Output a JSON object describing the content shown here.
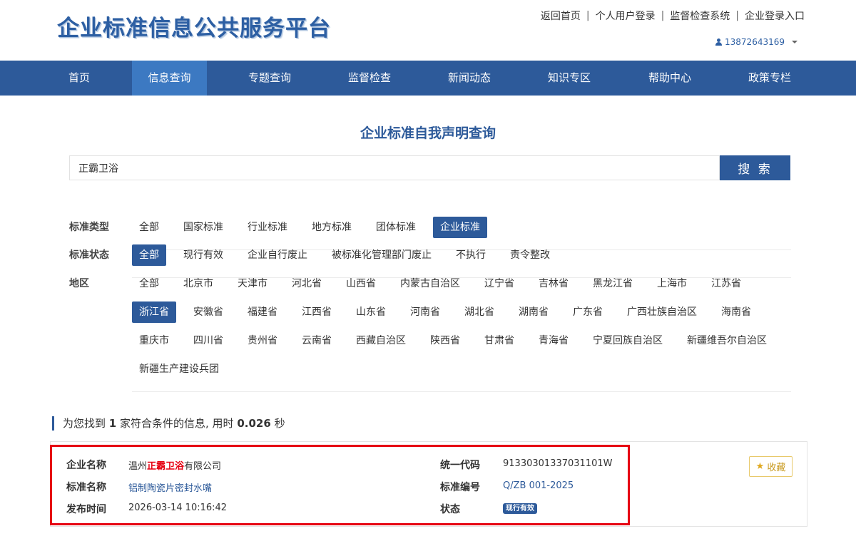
{
  "header": {
    "logo": "企业标准信息公共服务平台",
    "links": [
      "返回首页",
      "个人用户登录",
      "监督检查系统",
      "企业登录入口"
    ],
    "user": "13872643169"
  },
  "nav": {
    "items": [
      "首页",
      "信息查询",
      "专题查询",
      "监督检查",
      "新闻动态",
      "知识专区",
      "帮助中心",
      "政策专栏"
    ],
    "active": "信息查询"
  },
  "search": {
    "title": "企业标准自我声明查询",
    "value": "正霸卫浴",
    "button": "搜 索"
  },
  "filters": {
    "type": {
      "label": "标准类型",
      "options": [
        "全部",
        "国家标准",
        "行业标准",
        "地方标准",
        "团体标准",
        "企业标准"
      ],
      "selected": "企业标准"
    },
    "status": {
      "label": "标准状态",
      "options": [
        "全部",
        "现行有效",
        "企业自行废止",
        "被标准化管理部门废止",
        "不执行",
        "责令整改"
      ],
      "selected": "全部"
    },
    "region": {
      "label": "地区",
      "options": [
        "全部",
        "北京市",
        "天津市",
        "河北省",
        "山西省",
        "内蒙古自治区",
        "辽宁省",
        "吉林省",
        "黑龙江省",
        "上海市",
        "江苏省",
        "浙江省",
        "安徽省",
        "福建省",
        "江西省",
        "山东省",
        "河南省",
        "湖北省",
        "湖南省",
        "广东省",
        "广西壮族自治区",
        "海南省",
        "重庆市",
        "四川省",
        "贵州省",
        "云南省",
        "西藏自治区",
        "陕西省",
        "甘肃省",
        "青海省",
        "宁夏回族自治区",
        "新疆维吾尔自治区",
        "新疆生产建设兵团"
      ],
      "selected": "浙江省"
    }
  },
  "result_info": {
    "prefix": "为您找到",
    "count": "1",
    "middle": "家符合条件的信息, 用时",
    "time": "0.026",
    "suffix": "秒"
  },
  "result": {
    "company_label": "企业名称",
    "company_pre": "温州",
    "company_hl": "正霸卫浴",
    "company_post": "有限公司",
    "std_name_label": "标准名称",
    "std_name": "铝制陶瓷片密封水嘴",
    "publish_label": "发布时间",
    "publish_time": "2026-03-14 10:16:42",
    "code_label": "统一代码",
    "code": "91330301337031101W",
    "std_no_label": "标准编号",
    "std_no": "Q/ZB 001-2025",
    "status_label": "状态",
    "status": "现行有效",
    "fav": "收藏"
  }
}
